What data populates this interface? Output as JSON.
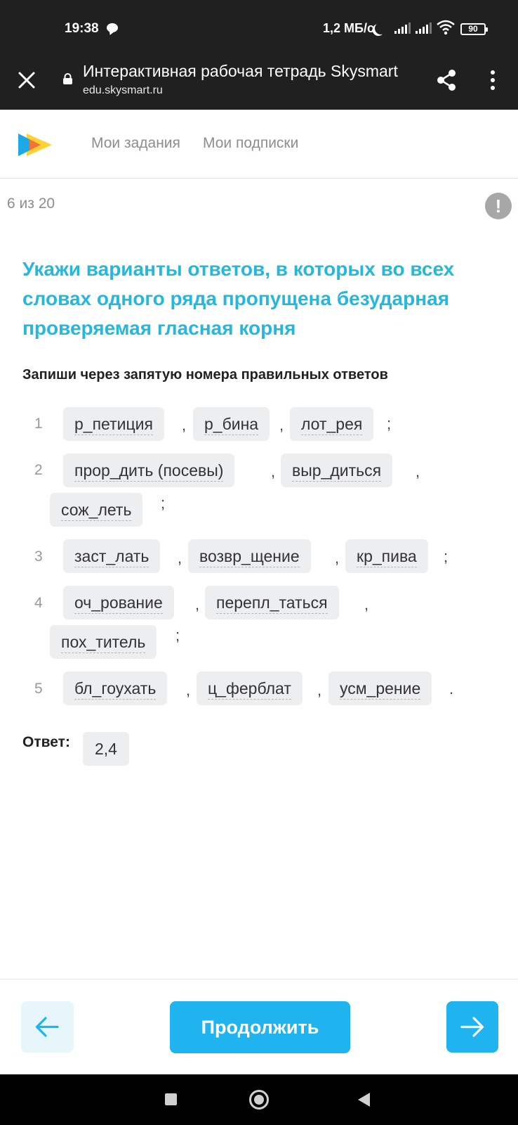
{
  "status_bar": {
    "time": "19:38",
    "speed": "1,2 МБ/с",
    "battery": "90"
  },
  "browser": {
    "title": "Интерактивная рабочая тетрадь Skysmart",
    "url": "edu.skysmart.ru"
  },
  "header": {
    "nav": [
      "Мои задания",
      "Мои подписки"
    ]
  },
  "task": {
    "progress": "6 из 20",
    "question": "Укажи варианты ответов, в которых во всех словах одного ряда пропущена безударная проверяемая гласная корня",
    "instruction": "Запиши через запятую номера правильных ответов",
    "items": [
      {
        "num": "1",
        "words": [
          "р_петиция",
          "р_бина",
          "лот_рея"
        ],
        "end": ";"
      },
      {
        "num": "2",
        "words": [
          "прор_дить (посевы)",
          "выр_диться",
          "сож_леть"
        ],
        "end": ";"
      },
      {
        "num": "3",
        "words": [
          "заст_лать",
          "возвр_щение",
          "кр_пива"
        ],
        "end": ";"
      },
      {
        "num": "4",
        "words": [
          "оч_рование",
          "перепл_таться",
          "пох_титель"
        ],
        "end": ";"
      },
      {
        "num": "5",
        "words": [
          "бл_гоухать",
          "ц_ферблат",
          "усм_рение"
        ],
        "end": "."
      }
    ],
    "separator": ",",
    "answer_label": "Ответ:",
    "answer_value": "2,4"
  },
  "footer": {
    "continue_label": "Продолжить"
  },
  "colors": {
    "accent": "#1fb4f0",
    "question_text": "#25b7dc",
    "chip_bg": "#eceef0"
  },
  "icons": {
    "close": "close-icon",
    "lock": "lock-icon",
    "share": "share-icon",
    "more": "more-vertical-icon",
    "report": "exclamation-icon",
    "prev": "arrow-left-icon",
    "next": "arrow-right-icon"
  }
}
